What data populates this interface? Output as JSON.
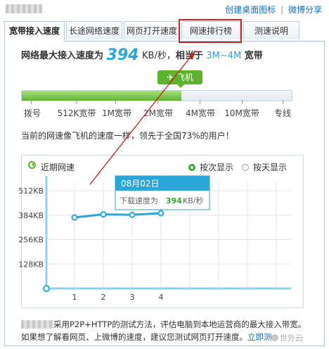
{
  "top_links": {
    "create_icon": "创建桌面图标",
    "separator": "|",
    "share": "微博分享"
  },
  "tabs": [
    {
      "label": "宽带接入速度",
      "active": true
    },
    {
      "label": "长途网络速度",
      "active": false
    },
    {
      "label": "网页打开速度",
      "active": false
    },
    {
      "label": "网速排行榜",
      "active": false,
      "highlighted": true
    },
    {
      "label": "测速说明",
      "active": false
    }
  ],
  "headline": {
    "prefix": "网络最大接入速度为",
    "speed": "394",
    "unit": "KB/秒，",
    "equiv": "相当于",
    "range": "3M~4M",
    "suffix": "宽带"
  },
  "badge_label": "飞机",
  "speed_bar": {
    "fill_fraction": 0.59,
    "fill_color": "#5fb52f"
  },
  "scale_labels": [
    "拨号",
    "512K宽带",
    "1M宽带",
    "2M宽带",
    "4M宽带",
    "10M宽带",
    "专线"
  ],
  "compare_text": "当前的网速像飞机的速度一样，领先于全国73%的用户！",
  "chart_panel": {
    "title": "近期网速",
    "radio_by_count": "按次显示",
    "radio_by_day": "按天显示",
    "selected": "按次显示"
  },
  "tooltip": {
    "date": "08月02日",
    "label": "下载速度为",
    "value": "394",
    "unit": "KB/秒"
  },
  "chart_data": {
    "type": "line",
    "x": [
      1,
      2,
      3,
      4
    ],
    "series": [
      {
        "values": [
          372,
          388,
          386,
          394
        ]
      }
    ],
    "yticks": [
      "512KB",
      "384KB",
      "256KB",
      "128KB"
    ],
    "ytick_values": [
      512,
      384,
      256,
      128
    ],
    "xticks": [
      "1",
      "2",
      "3",
      "4"
    ],
    "ylim": [
      0,
      560
    ],
    "grid": true,
    "line_color": "#2aa6d8"
  },
  "note": {
    "line1": "采用P2P+HTTP的测试方法，评估电脑到本地运营商的最大接入带宽。",
    "line2": "如果想了解看网页、上微博的速度，建议您测试网页打开速度。",
    "link": "立即测"
  },
  "watermark": "世外云"
}
